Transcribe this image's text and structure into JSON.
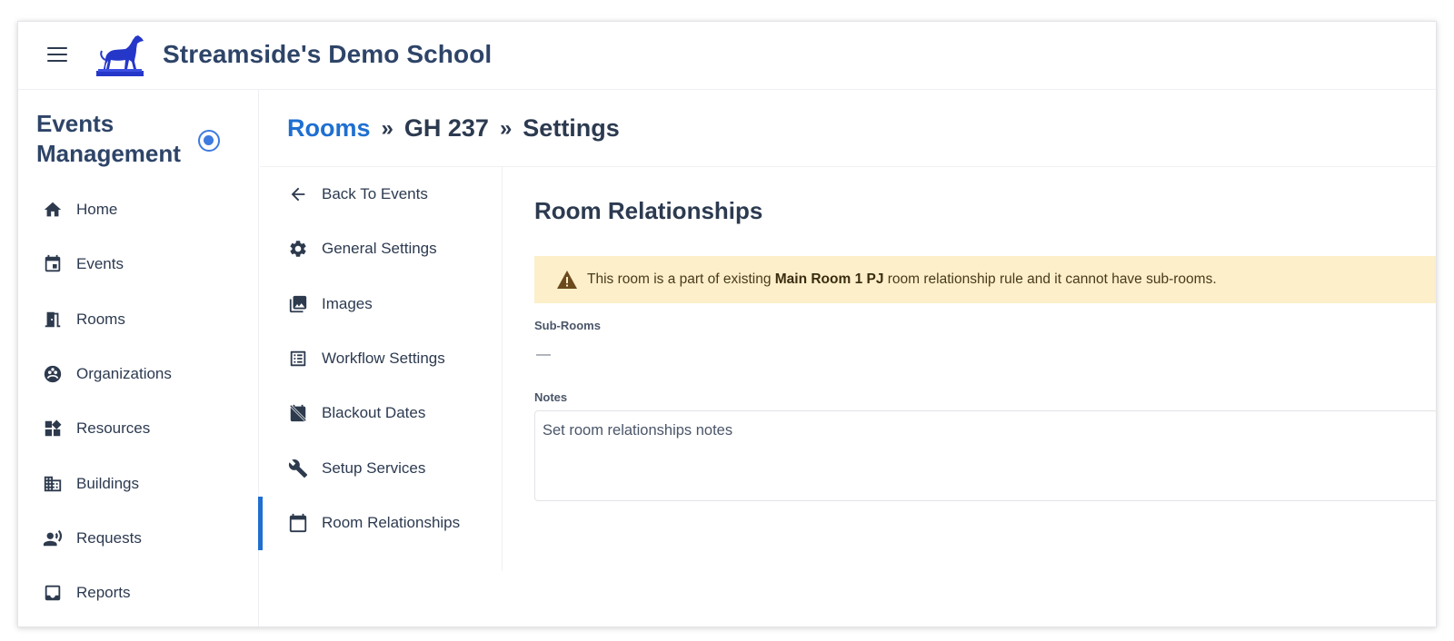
{
  "header": {
    "school_name": "Streamside's Demo School",
    "menu_icon": "hamburger-menu-icon",
    "logo": "greyhound-logo"
  },
  "sidebar": {
    "title": "Events Management",
    "items": [
      {
        "label": "Home",
        "icon": "home-icon"
      },
      {
        "label": "Events",
        "icon": "calendar-event-icon"
      },
      {
        "label": "Rooms",
        "icon": "door-icon"
      },
      {
        "label": "Organizations",
        "icon": "organizations-icon"
      },
      {
        "label": "Resources",
        "icon": "widgets-icon"
      },
      {
        "label": "Buildings",
        "icon": "building-icon"
      },
      {
        "label": "Requests",
        "icon": "record-voice-icon"
      },
      {
        "label": "Reports",
        "icon": "inbox-icon"
      }
    ]
  },
  "breadcrumb": {
    "root": "Rooms",
    "sep1": "»",
    "room": "GH 237",
    "sep2": "»",
    "page": "Settings"
  },
  "subnav": {
    "items": [
      {
        "label": "Back To Events",
        "icon": "arrow-left-icon"
      },
      {
        "label": "General Settings",
        "icon": "gear-icon"
      },
      {
        "label": "Images",
        "icon": "images-icon"
      },
      {
        "label": "Workflow Settings",
        "icon": "list-icon"
      },
      {
        "label": "Blackout Dates",
        "icon": "event-busy-icon"
      },
      {
        "label": "Setup Services",
        "icon": "wrench-icon"
      },
      {
        "label": "Room Relationships",
        "icon": "calendar-icon"
      }
    ],
    "active_index": 6
  },
  "main": {
    "title": "Room Relationships",
    "alert": {
      "prefix": "This room is a part of existing ",
      "bold": "Main Room 1 PJ",
      "suffix": " room relationship rule and it cannot have sub-rooms.",
      "icon": "warning-icon"
    },
    "subrooms_label": "Sub-Rooms",
    "subrooms_value": "—",
    "notes_label": "Notes",
    "notes_placeholder": "Set room relationships notes"
  },
  "colors": {
    "brand_blue": "#1f6fd1",
    "heading": "#2e4468",
    "alert_bg": "#fcefc9",
    "logo_blue": "#2537c9"
  }
}
